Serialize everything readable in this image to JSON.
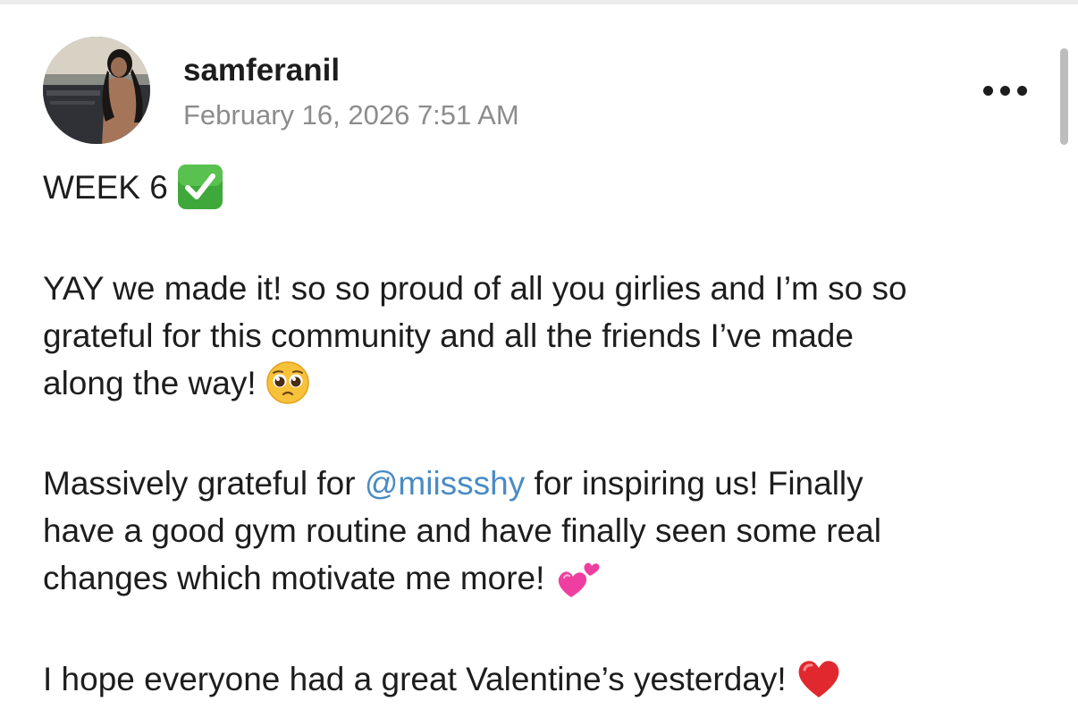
{
  "post": {
    "author": "samferanil",
    "timestamp": "February 16, 2026 7:51 AM",
    "heading": "WEEK 6",
    "paragraph1": {
      "line1": "YAY we made it! so so proud of all you girlies and I’m so so",
      "line2": "grateful for this community and all the friends I’ve made",
      "line3": "along the way!"
    },
    "paragraph2": {
      "line1_start": "Massively grateful for",
      "mention": "@miissshy",
      "line1_end": "for inspiring us! Finally",
      "line2": "have a good gym routine and have finally seen some real",
      "line3": "changes which motivate me more!"
    },
    "paragraph3": {
      "line1": "I hope everyone had a great Valentine’s yesterday!"
    }
  },
  "icons": {
    "more": "more-options-icon",
    "check": "check-mark-button-emoji",
    "pleading": "pleading-face-emoji",
    "hearts": "two-hearts-emoji",
    "heart": "red-heart-emoji"
  },
  "colors": {
    "mention": "#4a8bc4",
    "timestamp": "#8c8c8c",
    "text": "#1d1d1d"
  }
}
